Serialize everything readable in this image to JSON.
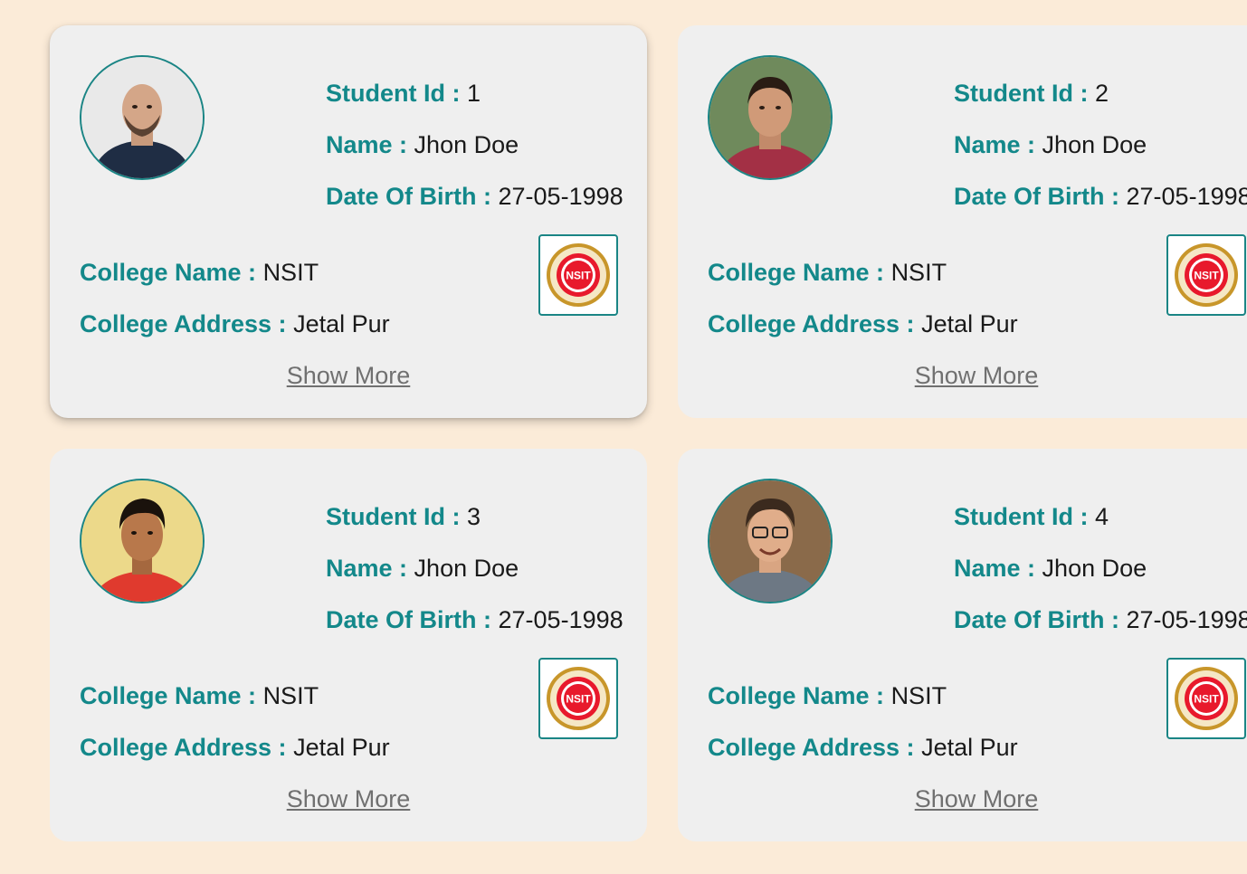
{
  "labels": {
    "student_id": "Student Id : ",
    "name": "Name : ",
    "dob": "Date Of Birth : ",
    "college_name": "College Name : ",
    "college_address": "College Address : ",
    "show_more": "Show More",
    "logo_text": "NSIT"
  },
  "colors": {
    "background": "#fbebd8",
    "card": "#efefef",
    "label": "#13888a",
    "border": "#1a8585",
    "link": "#707070",
    "logo_red": "#e8192c",
    "logo_gold": "#c8962a"
  },
  "students": [
    {
      "id": "1",
      "name": "Jhon Doe",
      "dob": "27-05-1998",
      "college_name": "NSIT",
      "college_address": "Jetal Pur",
      "avatar_icon": "person-photo-bald-man"
    },
    {
      "id": "2",
      "name": "Jhon Doe",
      "dob": "27-05-1998",
      "college_name": "NSIT",
      "college_address": "Jetal Pur",
      "avatar_icon": "person-photo-man-red-shirt"
    },
    {
      "id": "3",
      "name": "Jhon Doe",
      "dob": "27-05-1998",
      "college_name": "NSIT",
      "college_address": "Jetal Pur",
      "avatar_icon": "person-photo-young-man"
    },
    {
      "id": "4",
      "name": "Jhon Doe",
      "dob": "27-05-1998",
      "college_name": "NSIT",
      "college_address": "Jetal Pur",
      "avatar_icon": "person-photo-man-glasses"
    }
  ]
}
